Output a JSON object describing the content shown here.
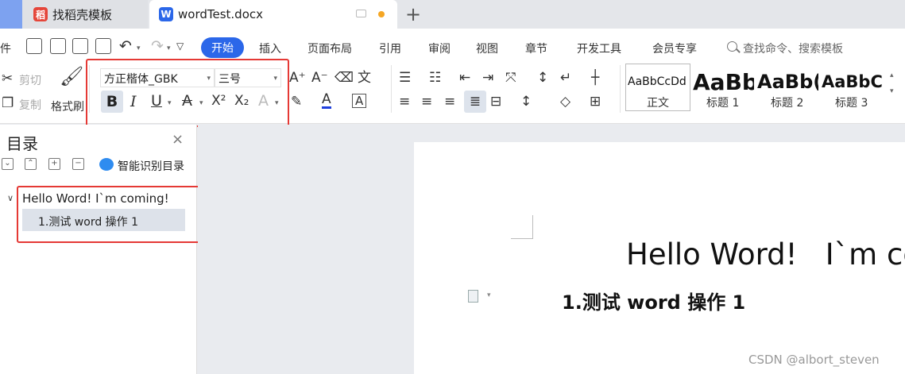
{
  "tabs": {
    "template_tab": "找稻壳模板",
    "doc_tab": "wordTest.docx",
    "new_tab_symbol": "+"
  },
  "menu": {
    "left_partial": "件",
    "items": [
      "开始",
      "插入",
      "页面布局",
      "引用",
      "审阅",
      "视图",
      "章节",
      "开发工具",
      "会员专享"
    ],
    "search": "查找命令、搜索模板"
  },
  "clipboard": {
    "cut": "剪切",
    "copy": "复制",
    "format_painter": "格式刷"
  },
  "font": {
    "family": "方正楷体_GBK",
    "size": "三号",
    "bold": "B",
    "italic": "I",
    "underline": "U",
    "strike": "A",
    "superscript": "X²",
    "subscript": "X₂",
    "color_a": "A",
    "text_effect": "A"
  },
  "styles": [
    {
      "sample": "AaBbCcDd",
      "name": "正文"
    },
    {
      "sample": "AaBb",
      "name": "标题 1"
    },
    {
      "sample": "AaBb(",
      "name": "标题 2"
    },
    {
      "sample": "AaBbC",
      "name": "标题 3"
    }
  ],
  "nav": {
    "title": "目录",
    "close": "×",
    "smart_toc": "智能识别目录",
    "outline": [
      "Hello Word!  I`m coming!",
      "1.测试 word 操作 1"
    ]
  },
  "document": {
    "heading": "Hello Word!   I`m co",
    "subheading": "1.测试 word 操作 1"
  },
  "watermark": "CSDN @albort_steven",
  "colors": {
    "accent": "#2b67e9",
    "highlight_box": "#e53935",
    "tab_dot": "#f5a623"
  }
}
